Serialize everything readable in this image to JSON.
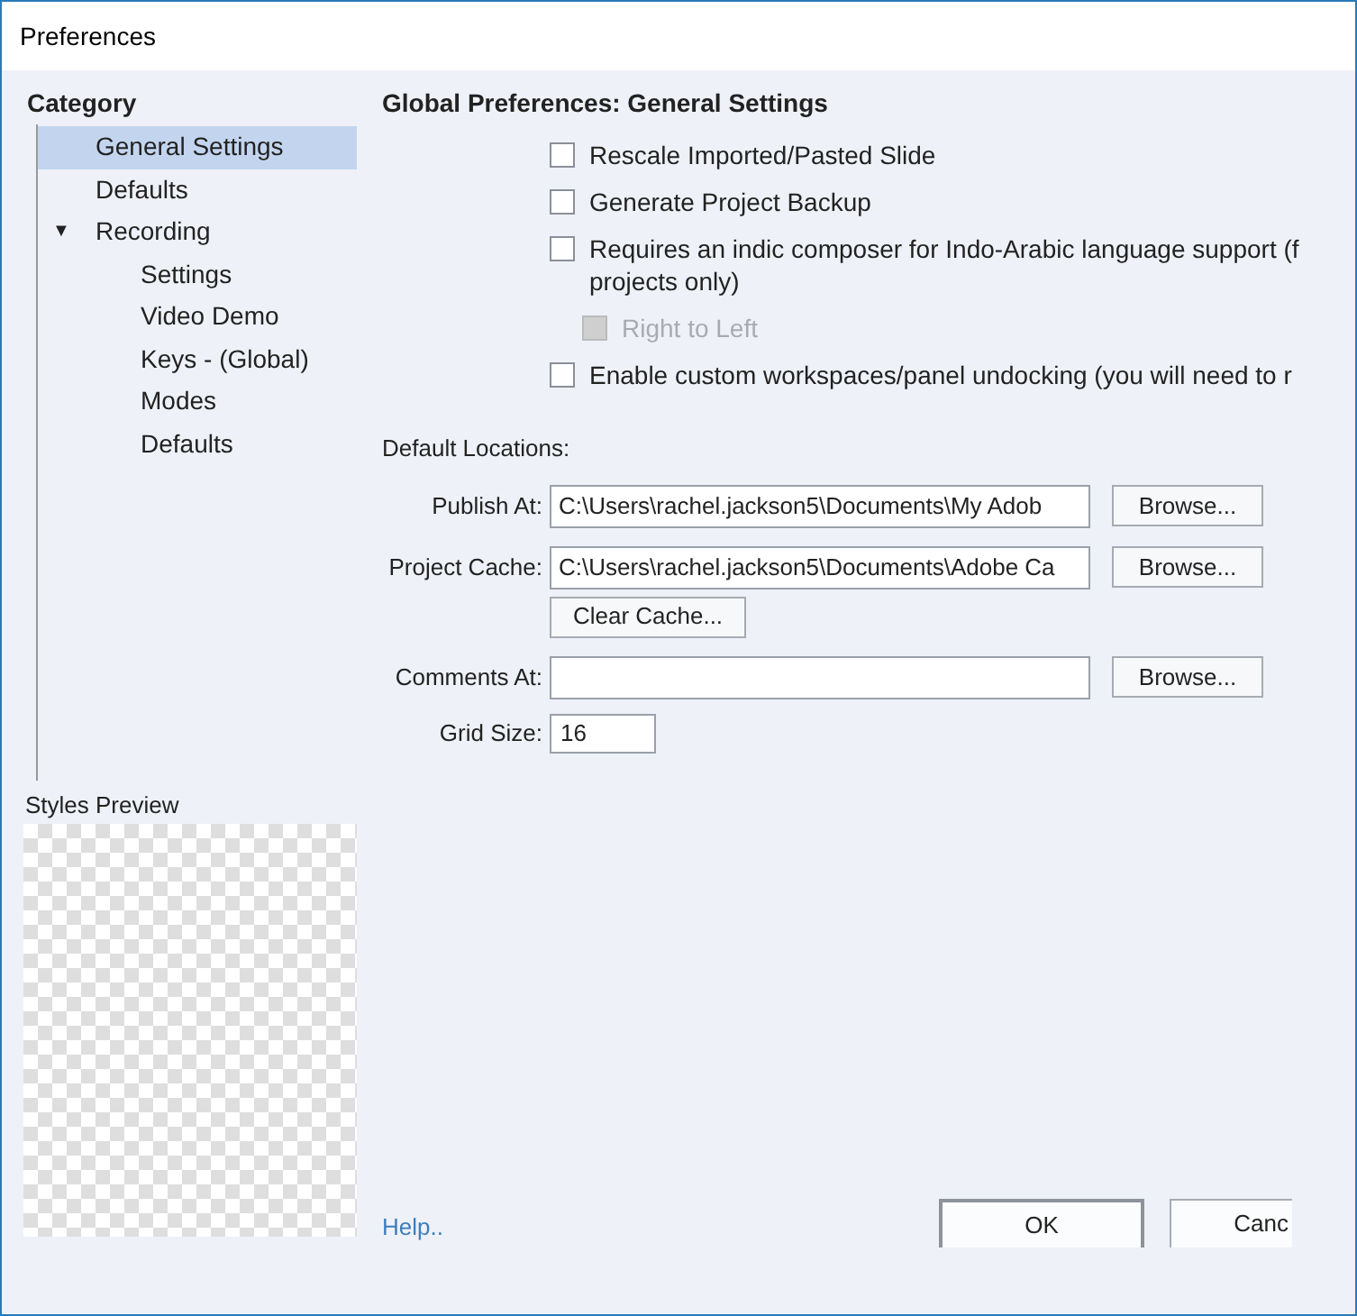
{
  "window": {
    "title": "Preferences"
  },
  "category": {
    "heading": "Category",
    "items": [
      {
        "label": "General Settings",
        "selected": true
      },
      {
        "label": "Defaults",
        "selected": false
      },
      {
        "label": "Recording",
        "selected": false,
        "expanded": true,
        "toggle": "▼",
        "children": [
          {
            "label": "Settings",
            "selected": false
          },
          {
            "label": "Video Demo",
            "selected": false
          },
          {
            "label": "Keys - (Global)",
            "selected": false
          },
          {
            "label": "Modes",
            "selected": false
          },
          {
            "label": "Defaults",
            "selected": false
          }
        ]
      }
    ]
  },
  "styles_preview": {
    "title": "Styles Preview"
  },
  "panel": {
    "title": "Global Preferences: General Settings",
    "options": [
      {
        "label_lines": [
          "Rescale Imported/Pasted Slide"
        ],
        "checked": false,
        "disabled": false
      },
      {
        "label_lines": [
          "Generate Project Backup"
        ],
        "checked": false,
        "disabled": false
      },
      {
        "label_lines": [
          "Requires an indic composer for Indo-Arabic language support (f",
          "projects only)"
        ],
        "checked": false,
        "disabled": false,
        "children": [
          {
            "label_lines": [
              "Right to Left"
            ],
            "checked": false,
            "disabled": true
          }
        ]
      },
      {
        "label_lines": [
          "Enable custom workspaces/panel undocking (you will need to r"
        ],
        "checked": false,
        "disabled": false
      }
    ],
    "locations_heading": "Default Locations:",
    "locations": [
      {
        "label": "Publish At:",
        "value": "C:\\Users\\rachel.jackson5\\Documents\\My Adob",
        "button": "Browse..."
      },
      {
        "label": "Project Cache:",
        "value": "C:\\Users\\rachel.jackson5\\Documents\\Adobe Ca",
        "button": "Browse...",
        "extra_button": "Clear Cache..."
      },
      {
        "label": "Comments At:",
        "button": "Browse..."
      }
    ],
    "grid_size": {
      "label": "Grid Size:",
      "value": "16"
    }
  },
  "footer": {
    "help": "Help..",
    "ok": "OK",
    "cancel": "Canc"
  }
}
